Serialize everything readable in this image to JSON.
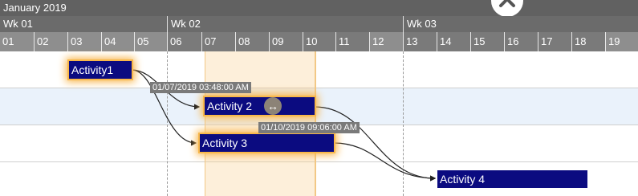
{
  "header": {
    "month": "January 2019",
    "weeks": [
      "Wk 01",
      "Wk 02",
      "Wk 03"
    ],
    "days": [
      "01",
      "02",
      "03",
      "04",
      "05",
      "06",
      "07",
      "08",
      "09",
      "10",
      "11",
      "12",
      "13",
      "14",
      "15",
      "16",
      "17",
      "18",
      "19"
    ]
  },
  "tasks": [
    {
      "label": "Activity1"
    },
    {
      "label": "Activity 2"
    },
    {
      "label": "Activity 3"
    },
    {
      "label": "Activity 4"
    }
  ],
  "tooltips": {
    "start": "01/07/2019 03:48:00 AM",
    "end": "01/10/2019 09:06:00 AM"
  },
  "icons": {
    "resize": "left-right-arrow-icon",
    "collapse": "chevron-up-icon"
  },
  "colors": {
    "bar": "#0b0b80",
    "highlight": "#f8b54a",
    "header": "#6b6b6b"
  }
}
